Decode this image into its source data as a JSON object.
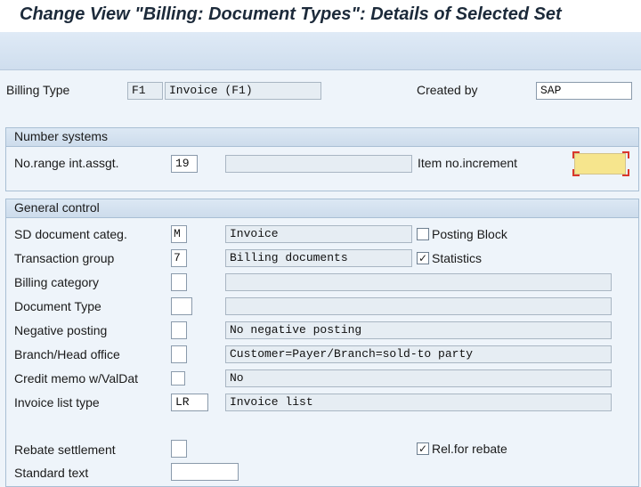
{
  "window": {
    "title": "Change View \"Billing: Document Types\": Details of Selected Set"
  },
  "header": {
    "billing_type_label": "Billing Type",
    "billing_type_value": "F1",
    "billing_type_desc": "Invoice (F1)",
    "created_by_label": "Created by",
    "created_by_value": "SAP"
  },
  "number_systems": {
    "title": "Number systems",
    "no_range_label": "No.range int.assgt.",
    "no_range_value": "19",
    "no_range_desc": "",
    "item_increment_label": "Item no.increment",
    "item_increment_value": ""
  },
  "general_control": {
    "title": "General control",
    "sd_categ_label": "SD document categ.",
    "sd_categ_value": "M",
    "sd_categ_desc": "Invoice",
    "posting_block_label": "Posting Block",
    "posting_block_checked": false,
    "transaction_group_label": "Transaction group",
    "transaction_group_value": "7",
    "transaction_group_desc": "Billing documents",
    "statistics_label": "Statistics",
    "statistics_checked": true,
    "billing_category_label": "Billing category",
    "billing_category_value": "",
    "billing_category_desc": "",
    "document_type_label": "Document Type",
    "document_type_value": "",
    "document_type_desc": "",
    "negative_posting_label": "Negative posting",
    "negative_posting_value": "",
    "negative_posting_desc": "No negative posting",
    "branch_head_label": "Branch/Head office",
    "branch_head_value": "",
    "branch_head_desc": "Customer=Payer/Branch=sold-to party",
    "credit_memo_label": "Credit memo w/ValDat",
    "credit_memo_value": "",
    "credit_memo_desc": "No",
    "invoice_list_type_label": "Invoice list type",
    "invoice_list_type_value": "LR",
    "invoice_list_type_desc": "Invoice list",
    "rebate_settlement_label": "Rebate settlement",
    "rebate_settlement_value": "",
    "rel_for_rebate_label": "Rel.for rebate",
    "rel_for_rebate_checked": true,
    "standard_text_label": "Standard text",
    "standard_text_value": ""
  },
  "colors": {
    "background": "#eef4fa",
    "required_field": "#f6e58d",
    "required_marker": "#d9372b"
  }
}
